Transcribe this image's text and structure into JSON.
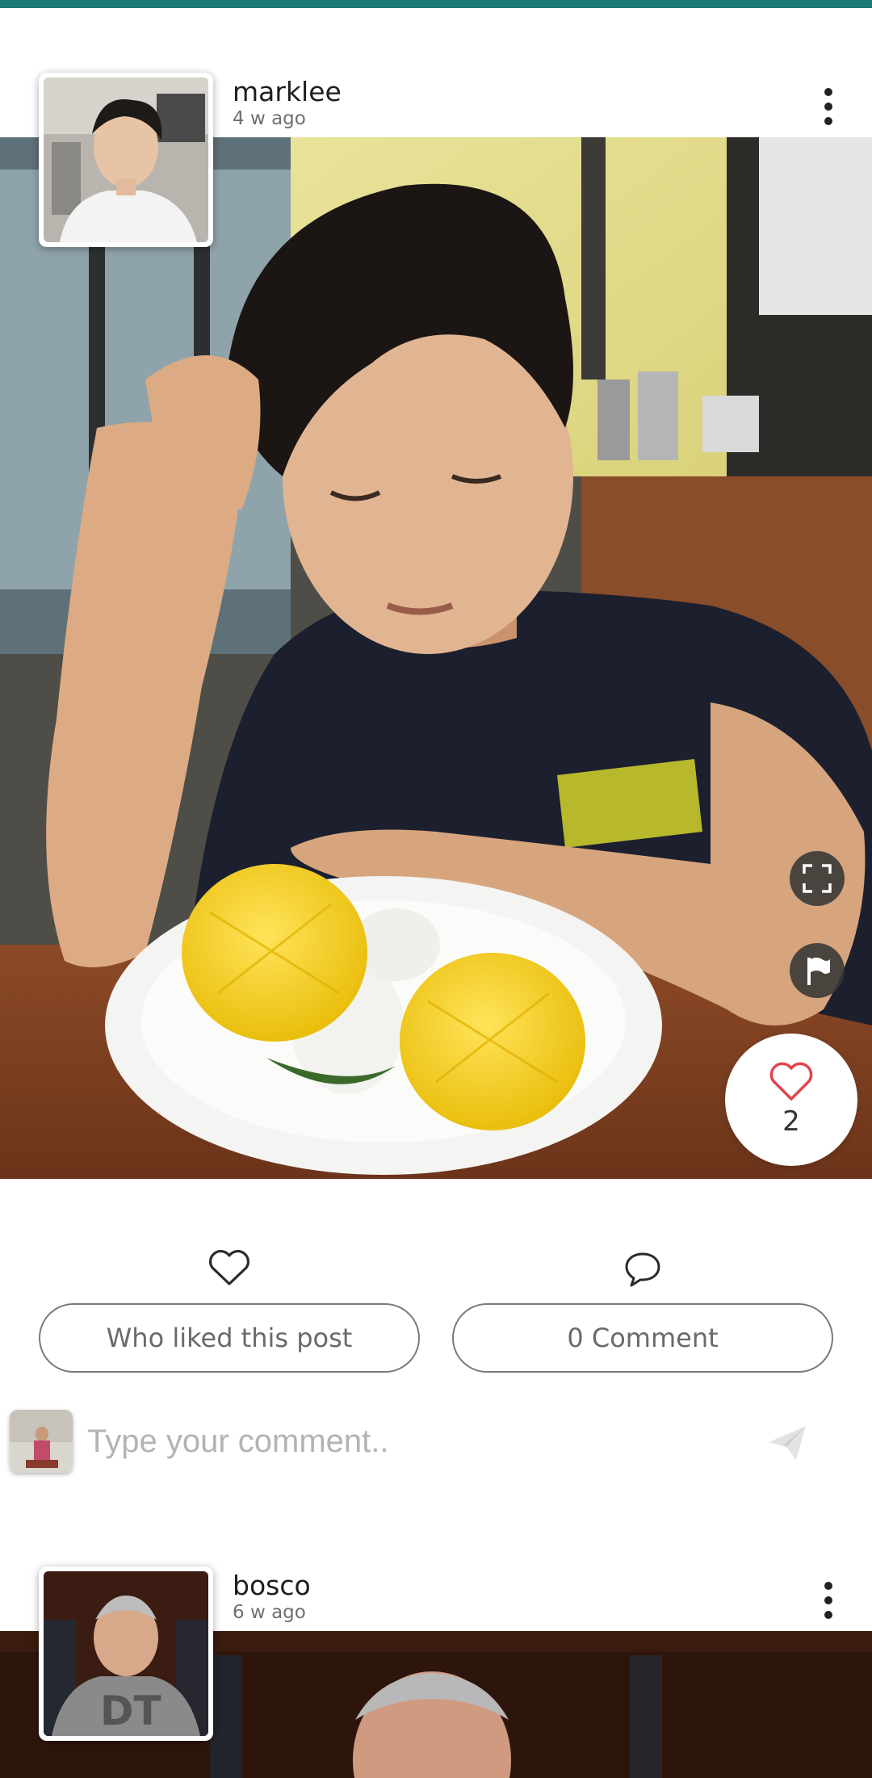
{
  "colors": {
    "top_bar": "#1a7a74",
    "like_heart": "#e0444d",
    "pill_border": "#7a7a7a"
  },
  "posts": [
    {
      "username": "marklee",
      "time_ago": "4 w ago",
      "like_count": "2",
      "who_liked_label": "Who liked this post",
      "comment_count_label": "0 Comment",
      "comment_placeholder": "Type your comment.."
    },
    {
      "username": "bosco",
      "time_ago": "6 w ago"
    }
  ],
  "icons": {
    "menu": "more-vertical-icon",
    "fullscreen": "fullscreen-icon",
    "report": "flag-icon",
    "like": "heart-icon",
    "comment": "speech-bubble-icon",
    "send": "send-icon"
  }
}
